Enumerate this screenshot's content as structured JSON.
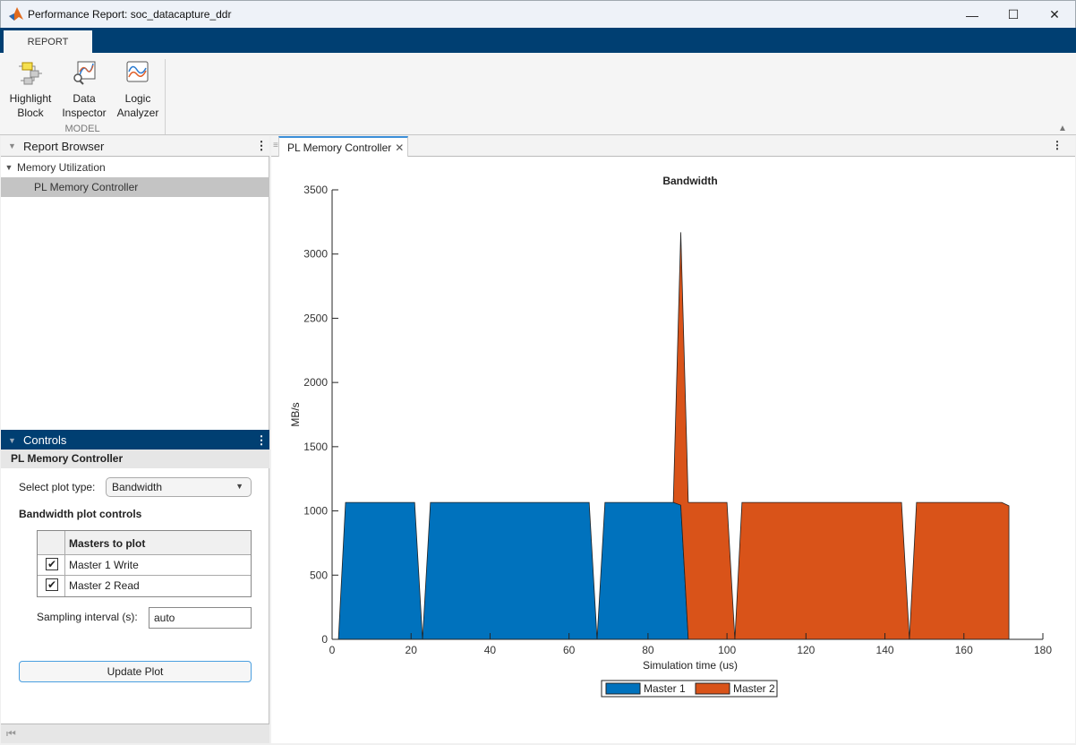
{
  "window": {
    "title": "Performance Report: soc_datacapture_ddr",
    "minimize": "—",
    "maximize": "☐",
    "close": "✕"
  },
  "ribbon": {
    "tab": "REPORT",
    "section": "MODEL",
    "tools": [
      {
        "l1": "Highlight",
        "l2": "Block",
        "icon": "highlight-block-icon"
      },
      {
        "l1": "Data",
        "l2": "Inspector",
        "icon": "data-inspector-icon"
      },
      {
        "l1": "Logic",
        "l2": "Analyzer",
        "icon": "logic-analyzer-icon"
      }
    ]
  },
  "browser": {
    "title": "Report Browser",
    "group": "Memory Utilization",
    "item": "PL Memory Controller"
  },
  "controls": {
    "title": "Controls",
    "subtitle": "PL Memory Controller",
    "select_label": "Select plot type:",
    "select_value": "Bandwidth",
    "bw_label": "Bandwidth plot controls",
    "table_header": "Masters to plot",
    "masters": [
      {
        "label": "Master 1 Write",
        "checked": true
      },
      {
        "label": "Master 2 Read",
        "checked": true
      }
    ],
    "sampling_label": "Sampling interval (s):",
    "sampling_value": "auto",
    "update": "Update Plot"
  },
  "document": {
    "tab": "PL Memory Controller"
  },
  "chart_data": {
    "type": "area",
    "stacked": true,
    "title": "Bandwidth",
    "xlabel": "Simulation time (us)",
    "ylabel": "MB/s",
    "xlim": [
      0,
      180
    ],
    "ylim": [
      0,
      3500
    ],
    "xticks": [
      0,
      20,
      40,
      60,
      80,
      100,
      120,
      140,
      160,
      180
    ],
    "yticks": [
      0,
      500,
      1000,
      1500,
      2000,
      2500,
      3000,
      3500
    ],
    "grid": false,
    "legend": "bottom-center",
    "series": [
      {
        "name": "Master 1",
        "color": "#0072bd",
        "x": [
          1.6,
          3.4,
          20.9,
          22.9,
          24.9,
          65.1,
          67.1,
          69.1,
          87.6,
          88.3,
          90.2
        ],
        "y": [
          0,
          1066,
          1066,
          0,
          1066,
          1066,
          0,
          1066,
          1066,
          1045,
          0
        ]
      },
      {
        "name": "Master 2",
        "color": "#d95319",
        "x": [
          86.4,
          88.3,
          90.2,
          100,
          102,
          103.8,
          144.2,
          146.2,
          148,
          169.6,
          171.4,
          171.4
        ],
        "y": [
          0,
          2125,
          1066,
          1066,
          0,
          1066,
          1066,
          0,
          1066,
          1066,
          1040,
          0
        ]
      }
    ]
  }
}
